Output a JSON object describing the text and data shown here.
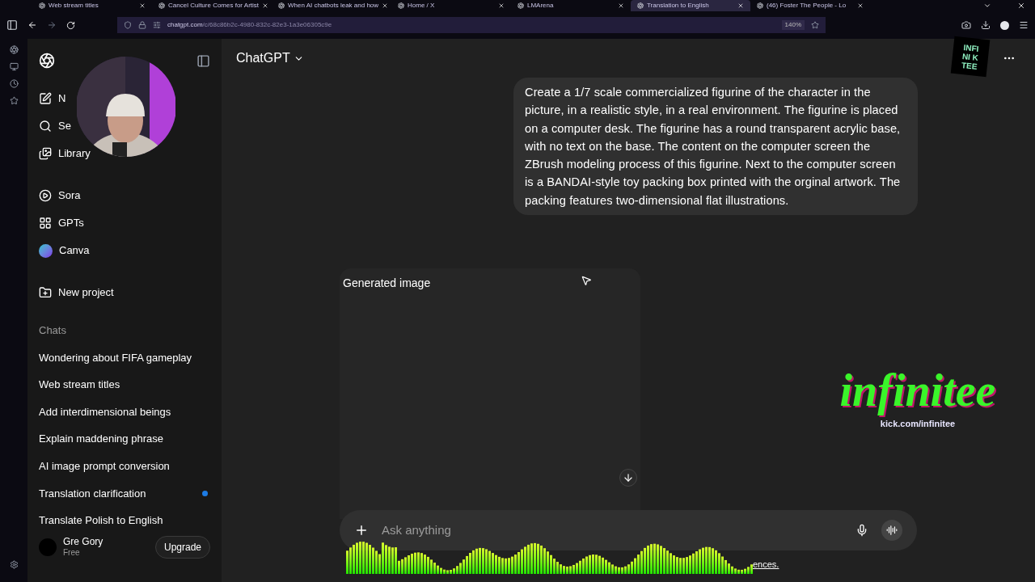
{
  "browser": {
    "tabs": [
      {
        "title": "Web stream titles",
        "selected": false
      },
      {
        "title": "Cancel Culture Comes for Artist",
        "selected": false
      },
      {
        "title": "When AI chatbots leak and how",
        "selected": false
      },
      {
        "title": "Home / X",
        "selected": false
      },
      {
        "title": "LMArena",
        "selected": false
      },
      {
        "title": "Translation to English",
        "selected": true
      },
      {
        "title": "(46) Foster The People - Lo",
        "selected": false
      }
    ],
    "url": {
      "domain": "chatgpt.com",
      "path": "/c/68c86b2c-4980-832c-82e3-1a3e06305c9e"
    },
    "zoom": "140%"
  },
  "sidebar": {
    "top_items": [
      {
        "label": "N"
      },
      {
        "label": "Se"
      },
      {
        "label": "Library"
      }
    ],
    "apps": [
      {
        "label": "Sora"
      },
      {
        "label": "GPTs"
      },
      {
        "label": "Canva"
      }
    ],
    "new_project": "New project",
    "chats_heading": "Chats",
    "chats": [
      {
        "title": "Wondering about FIFA gameplay",
        "unread": false
      },
      {
        "title": "Web stream titles",
        "unread": false
      },
      {
        "title": "Add interdimensional beings",
        "unread": false
      },
      {
        "title": "Explain maddening phrase",
        "unread": false
      },
      {
        "title": "AI image prompt conversion",
        "unread": false
      },
      {
        "title": "Translation clarification",
        "unread": true
      },
      {
        "title": "Translate Polish to English",
        "unread": false
      }
    ],
    "user": {
      "name": "Gre Gory",
      "plan": "Free",
      "upgrade": "Upgrade"
    }
  },
  "header": {
    "model": "ChatGPT"
  },
  "message": "Create a 1/7 scale commercialized figurine of the character in the picture, in a realistic style, in a real environment. The figurine is placed on a computer desk. The figurine has a round transparent acrylic base, with no text on the base. The content on the computer screen the ZBrush modeling process of this figurine. Next to the computer screen is a BANDAI-style toy packing box printed with the orginal artwork. The packing features two-dimensional flat illustrations.",
  "generated_image": {
    "label": "Generated image"
  },
  "composer": {
    "placeholder": "Ask anything"
  },
  "footer_link": "ences.",
  "overlay": {
    "badge": [
      "INFI",
      "NI K",
      "TEE"
    ],
    "logo": "infinitee",
    "logo_url": "kick.com/infinitee"
  }
}
